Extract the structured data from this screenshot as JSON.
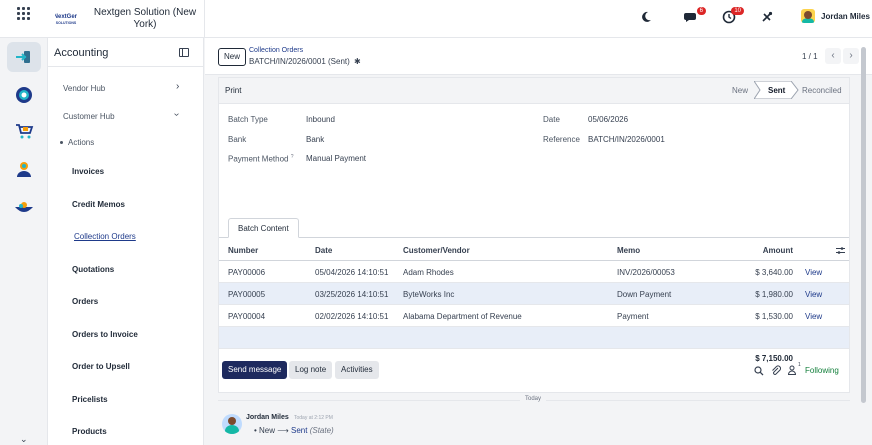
{
  "topbar": {
    "company_name": "Nextgen Solution (New York)",
    "logo_text": "NextGen SOLUTIONS",
    "messages_badge": "6",
    "activities_badge": "10",
    "user_name": "Jordan Miles"
  },
  "sidebar": {
    "title": "Accounting",
    "items": [
      {
        "label": "Vendor Hub"
      },
      {
        "label": "Customer Hub"
      },
      {
        "label": "Actions"
      },
      {
        "label": "Invoices"
      },
      {
        "label": "Credit Memos"
      },
      {
        "label": "Collection Orders"
      },
      {
        "label": "Quotations"
      },
      {
        "label": "Orders"
      },
      {
        "label": "Orders to Invoice"
      },
      {
        "label": "Order to Upsell"
      },
      {
        "label": "Pricelists"
      },
      {
        "label": "Products"
      }
    ]
  },
  "control": {
    "new_label": "New",
    "breadcrumb_parent": "Collection Orders",
    "breadcrumb_current": "BATCH/IN/2026/0001 (Sent)",
    "pager": "1 / 1"
  },
  "status": {
    "print_label": "Print",
    "stages": [
      "New",
      "Sent",
      "Reconciled"
    ]
  },
  "fields": {
    "batch_type_label": "Batch Type",
    "batch_type": "Inbound",
    "bank_label": "Bank",
    "bank": "Bank",
    "payment_method_label": "Payment Method",
    "payment_method_sup": "?",
    "payment_method": "Manual Payment",
    "date_label": "Date",
    "date": "05/06/2026",
    "reference_label": "Reference",
    "reference": "BATCH/IN/2026/0001"
  },
  "tab_label": "Batch Content",
  "table": {
    "headers": [
      "Number",
      "Date",
      "Customer/Vendor",
      "Memo",
      "Amount"
    ],
    "view_label": "View",
    "rows": [
      {
        "number": "PAY00006",
        "date": "05/04/2026 14:10:51",
        "partner": "Adam Rhodes",
        "memo": "INV/2026/00053",
        "amount": "$ 3,640.00"
      },
      {
        "number": "PAY00005",
        "date": "03/25/2026 14:10:51",
        "partner": "ByteWorks Inc",
        "memo": "Down Payment",
        "amount": "$ 1,980.00"
      },
      {
        "number": "PAY00004",
        "date": "02/02/2026 14:10:51",
        "partner": "Alabama Department of Revenue",
        "memo": "Payment",
        "amount": "$ 1,530.00"
      }
    ],
    "total": "$ 7,150.00"
  },
  "chatter": {
    "send_message": "Send message",
    "log_note": "Log note",
    "activities": "Activities",
    "followers_count": "1",
    "following": "Following",
    "today": "Today",
    "author": "Jordan Miles",
    "time": "Today at 2:12 PM",
    "from": "New",
    "to": "Sent",
    "field": "(State)"
  }
}
